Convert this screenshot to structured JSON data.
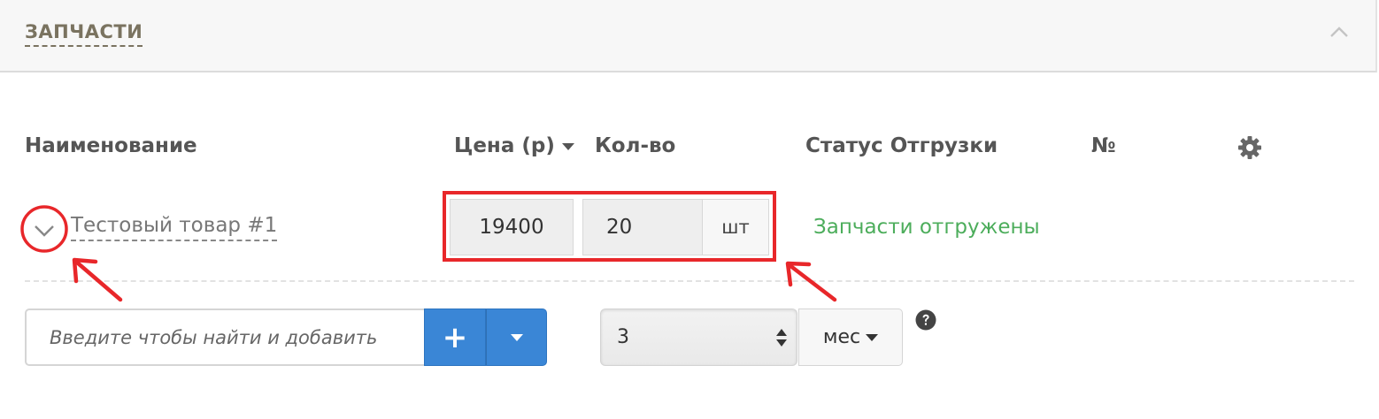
{
  "panel": {
    "title": "ЗАПЧАСТИ"
  },
  "table": {
    "headers": {
      "name": "Наименование",
      "price": "Цена (р)",
      "qty": "Кол-во",
      "status": "Статус Отгрузки",
      "number": "№"
    },
    "row": {
      "name": "Тестовый товар #1",
      "price": "19400",
      "qty": "20",
      "unit": "шт",
      "status": "Запчасти отгружены"
    }
  },
  "add_bar": {
    "search_placeholder": "Введите чтобы найти и добавить",
    "add_label": "+",
    "period_value": "3",
    "period_unit": "мес"
  },
  "colors": {
    "accent_blue": "#3a86d6",
    "status_green": "#4cad5b",
    "annotation_red": "#e8272a",
    "header_text": "#7a7360"
  },
  "icons": [
    "chevron-up-icon",
    "caret-down-icon",
    "gear-icon",
    "chevron-down-icon",
    "spin-icon",
    "question-circle-icon"
  ]
}
